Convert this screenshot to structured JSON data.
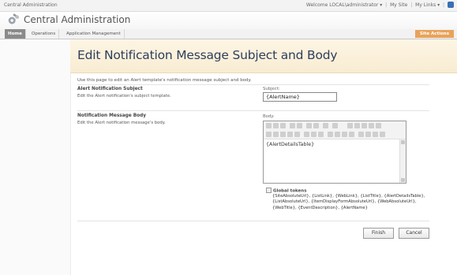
{
  "topbar": {
    "site_name": "Central Administration",
    "welcome": "Welcome LOCAL\\administrator ▾",
    "my_site": "My Site",
    "my_links": "My Links ▾",
    "sep": "|"
  },
  "brand": {
    "title": "Central Administration"
  },
  "tabs": [
    {
      "label": "Home"
    },
    {
      "label": "Operations"
    },
    {
      "label": "Application Management"
    }
  ],
  "site_actions": "Site Actions",
  "page": {
    "title": "Edit Notification Message Subject and Body",
    "intro": "Use this page to edit an Alert template's notification message subject and body."
  },
  "subject_section": {
    "title": "Alert Notification Subject",
    "desc": "Edit the Alert notification's subject template.",
    "field_label": "Subject:",
    "value": "{AlertName}"
  },
  "body_section": {
    "title": "Notification Message Body",
    "desc": "Edit the Alert notification message's body.",
    "field_label": "Body:",
    "value": "{AlertDetailsTable}"
  },
  "tokens": {
    "heading": "Global tokens",
    "text": "{SiteAbsoluteUrl}, {ListLink}, {WebLink}, {ListTitle}, {AlertDetailsTable}, {ListAbsoluteUrl}, {ItemDisplayFormAbsoluteUrl}, {WebAbsoluteUrl}, {WebTitle}, {EventDescription}, {AlertName}"
  },
  "buttons": {
    "finish": "Finish",
    "cancel": "Cancel"
  },
  "icons": {
    "brand": "gear-icon",
    "help": "help-icon",
    "collapse": "collapse-icon"
  }
}
